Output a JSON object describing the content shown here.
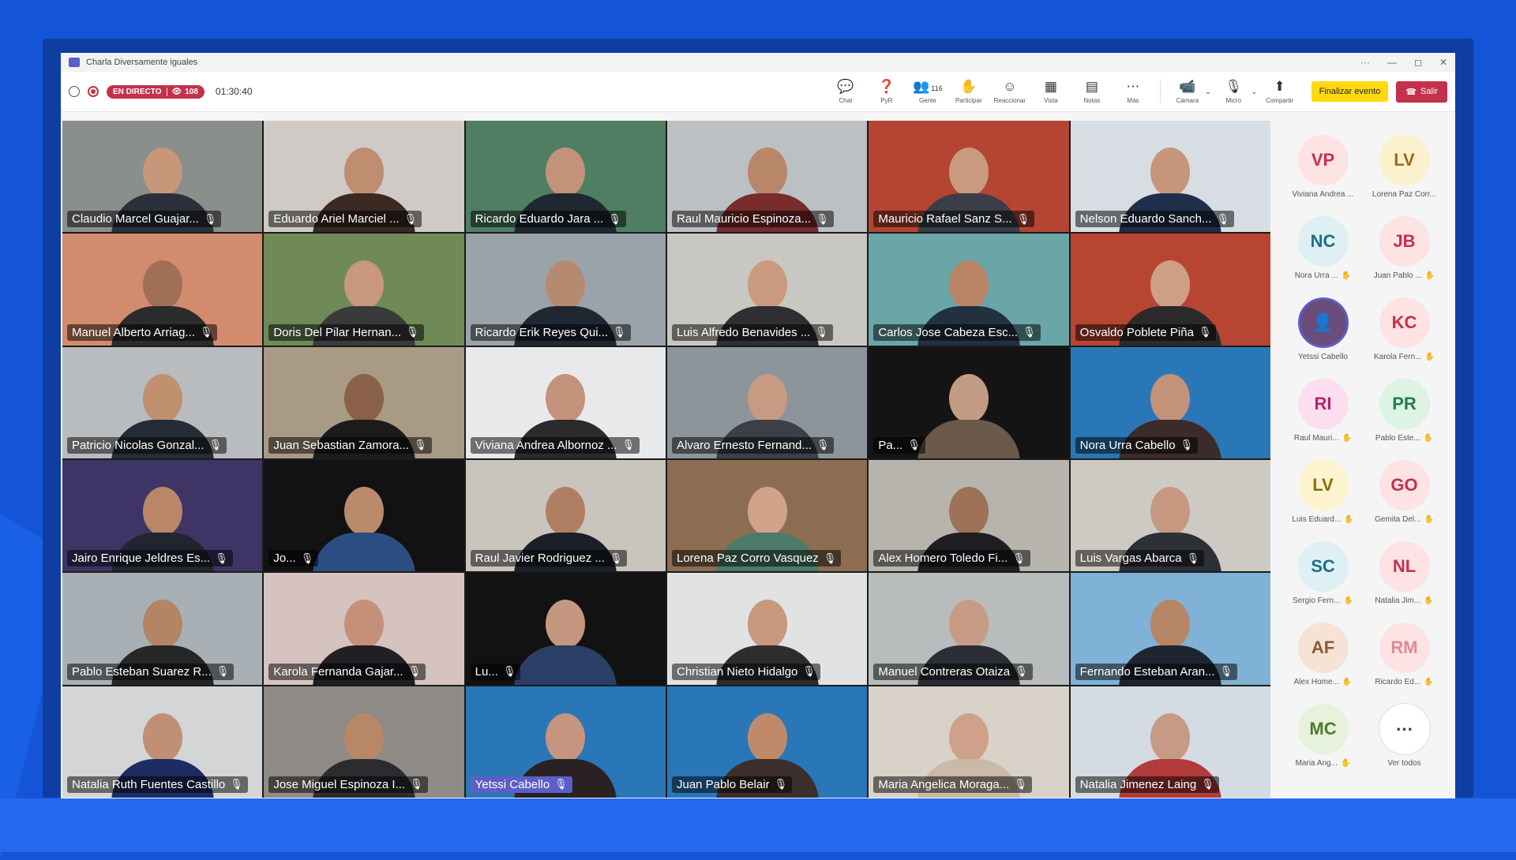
{
  "window": {
    "title": "Charla Diversamente iguales"
  },
  "toolbar": {
    "live_label": "EN DIRECTO",
    "viewers": "108",
    "elapsed": "01:30:40",
    "participant_count": "116",
    "actions": [
      {
        "icon": "chat-icon",
        "glyph": "💬",
        "label": "Chat"
      },
      {
        "icon": "qa-icon",
        "glyph": "❓",
        "label": "PyR"
      },
      {
        "icon": "people-icon",
        "glyph": "👥",
        "label": "Gente"
      },
      {
        "icon": "raise-hand-icon",
        "glyph": "✋",
        "label": "Participar"
      },
      {
        "icon": "react-icon",
        "glyph": "☺",
        "label": "Reaccionar"
      },
      {
        "icon": "view-icon",
        "glyph": "▦",
        "label": "Vista"
      },
      {
        "icon": "notes-icon",
        "glyph": "▤",
        "label": "Notas"
      },
      {
        "icon": "more-icon",
        "glyph": "⋯",
        "label": "Más"
      }
    ],
    "camera_label": "Cámara",
    "mic_label": "Micro",
    "share_label": "Compartir",
    "end_event_label": "Finalizar evento",
    "leave_label": "Salir"
  },
  "grid": {
    "tiles": [
      {
        "name": "Claudio Marcel Guajar...",
        "bg": "#8a8f8c",
        "skin": "#c7977a",
        "shirt": "#2a2f3a"
      },
      {
        "name": "Eduardo Ariel Marciel ...",
        "bg": "#cfcac5",
        "skin": "#bf8d6f",
        "shirt": "#3a2a22"
      },
      {
        "name": "Ricardo Eduardo Jara ...",
        "bg": "#4f7e63",
        "skin": "#c49279",
        "shirt": "#1f2731"
      },
      {
        "name": "Raul Mauricio Espinoza...",
        "bg": "#bcc0c3",
        "skin": "#b88769",
        "shirt": "#7a2b2b"
      },
      {
        "name": "Mauricio Rafael Sanz S...",
        "bg": "#b44533",
        "skin": "#c99a7d",
        "shirt": "#3a3e48"
      },
      {
        "name": "Nelson Eduardo Sanch...",
        "bg": "#d8dde3",
        "skin": "#c6957a",
        "shirt": "#1f2e4a"
      },
      {
        "name": "Manuel Alberto Arriag...",
        "bg": "#d28b6c",
        "skin": "#a06f55",
        "shirt": "#2b2b2b"
      },
      {
        "name": "Doris Del Pilar Hernan...",
        "bg": "#6f8a56",
        "skin": "#c9987c",
        "shirt": "#3a3a3a"
      },
      {
        "name": "Ricardo Erik Reyes Qui...",
        "bg": "#9aa3a9",
        "skin": "#b58a70",
        "shirt": "#1f2733"
      },
      {
        "name": "Luis Alfredo Benavides ...",
        "bg": "#c9c7c2",
        "skin": "#c99a80",
        "shirt": "#2e2e33"
      },
      {
        "name": "Carlos Jose Cabeza Esc...",
        "bg": "#6aa5a8",
        "skin": "#b78566",
        "shirt": "#223040"
      },
      {
        "name": "Osvaldo Poblete Piña",
        "bg": "#b84532",
        "skin": "#cc9f86",
        "shirt": "#2a2a2a"
      },
      {
        "name": "Patricio Nicolas Gonzal...",
        "bg": "#b8bcbf",
        "skin": "#c0906f",
        "shirt": "#262c36"
      },
      {
        "name": "Juan Sebastian Zamora...",
        "bg": "#a99a86",
        "skin": "#8a6048",
        "shirt": "#1c1c1c"
      },
      {
        "name": "Viviana Andrea Albornoz ...",
        "bg": "#e8e9ea",
        "skin": "#c4927b",
        "shirt": "#2c2a2d"
      },
      {
        "name": "Alvaro Ernesto Fernand...",
        "bg": "#8d949a",
        "skin": "#c69b82",
        "shirt": "#3b4048"
      },
      {
        "name": "Pa...",
        "bg": "#141414",
        "skin": "#c39a82",
        "shirt": "#6b5a4a"
      },
      {
        "name": "Nora Urra Cabello",
        "bg": "#2a77b8",
        "skin": "#c4927a",
        "shirt": "#3b2b2b"
      },
      {
        "name": "Jairo Enrique Jeldres Es...",
        "bg": "#3e3566",
        "skin": "#b98768",
        "shirt": "#222430"
      },
      {
        "name": "Jo...",
        "bg": "#121212",
        "skin": "#b98a6c",
        "shirt": "#2c4e83"
      },
      {
        "name": "Raul Javier Rodriguez ...",
        "bg": "#c9c5bd",
        "skin": "#b07f63",
        "shirt": "#1b1f29"
      },
      {
        "name": "Lorena Paz Corro Vasquez",
        "bg": "#8c6d52",
        "skin": "#d1a28a",
        "shirt": "#4e7a6a"
      },
      {
        "name": "Alex Homero Toledo Fi...",
        "bg": "#b7b4ad",
        "skin": "#9d7258",
        "shirt": "#1e1e22"
      },
      {
        "name": "Luis Vargas Abarca",
        "bg": "#cdcac4",
        "skin": "#c7987f",
        "shirt": "#2e3038"
      },
      {
        "name": "Pablo Esteban Suarez R...",
        "bg": "#a8b0b5",
        "skin": "#b48465",
        "shirt": "#262626"
      },
      {
        "name": "Karola Fernanda Gajar...",
        "bg": "#d6c3bf",
        "skin": "#c49077",
        "shirt": "#1f1f24"
      },
      {
        "name": "Lu...",
        "bg": "#121212",
        "skin": "#c59780",
        "shirt": "#2a3e66"
      },
      {
        "name": "Christian Nieto Hidalgo",
        "bg": "#e1e2e2",
        "skin": "#c7977e",
        "shirt": "#2d2d2d"
      },
      {
        "name": "Manuel Contreras Otaiza",
        "bg": "#b9bcbc",
        "skin": "#c89b84",
        "shirt": "#2b2e36"
      },
      {
        "name": "Fernando Esteban Aran...",
        "bg": "#7fb2d6",
        "skin": "#b78666",
        "shirt": "#1f2530"
      },
      {
        "name": "Natalia Ruth Fuentes Castillo",
        "bg": "#d4d5d6",
        "skin": "#c08f76",
        "shirt": "#1d2c63"
      },
      {
        "name": "Jose Miguel Espinoza I...",
        "bg": "#8f8b86",
        "skin": "#b88768",
        "shirt": "#2c2c30"
      },
      {
        "name": "Yetssi Cabello",
        "bg": "#2a77b8",
        "skin": "#c69580",
        "shirt": "#2a2222",
        "highlight": true
      },
      {
        "name": "Juan Pablo Belair",
        "bg": "#2a77b8",
        "skin": "#bf8a6b",
        "shirt": "#3a2f2a"
      },
      {
        "name": "Maria Angelica Moraga...",
        "bg": "#d8d2c8",
        "skin": "#cfa08a",
        "shirt": "#c9b9a6"
      },
      {
        "name": "Natalia Jimenez Laing",
        "bg": "#d5dbe2",
        "skin": "#c79a86",
        "shirt": "#b13a3a"
      }
    ]
  },
  "participants": [
    {
      "initials": "VP",
      "name": "Viviana Andrea ...",
      "bg": "#fde3e3",
      "fg": "#c4314b"
    },
    {
      "initials": "LV",
      "name": "Lorena Paz Corr...",
      "bg": "#fdf0cf",
      "fg": "#9b6a15"
    },
    {
      "initials": "NC",
      "name": "Nora Urra ...",
      "bg": "#dff0f5",
      "fg": "#1d6f85",
      "hand": true
    },
    {
      "initials": "JB",
      "name": "Juan Pablo ...",
      "bg": "#fde3e3",
      "fg": "#c4314b",
      "hand": true
    },
    {
      "initials": "",
      "name": "Yetssi Cabello",
      "photo": true
    },
    {
      "initials": "KC",
      "name": "Karola Fern...",
      "bg": "#fde3e3",
      "fg": "#c4314b",
      "hand": true
    },
    {
      "initials": "RI",
      "name": "Raul Mauri...",
      "bg": "#fbdff0",
      "fg": "#b4236f",
      "hand": true
    },
    {
      "initials": "PR",
      "name": "Pablo Este...",
      "bg": "#ddf3e3",
      "fg": "#237b4b",
      "hand": true
    },
    {
      "initials": "LV",
      "name": "Luis Eduard...",
      "bg": "#fdf3cf",
      "fg": "#8a6d0b",
      "hand": true
    },
    {
      "initials": "GO",
      "name": "Gemita Del...",
      "bg": "#fde3e3",
      "fg": "#c4314b",
      "hand": true
    },
    {
      "initials": "SC",
      "name": "Sergio Fern...",
      "bg": "#dff0f5",
      "fg": "#1d6f85",
      "hand": true
    },
    {
      "initials": "NL",
      "name": "Natalia Jim...",
      "bg": "#fde3e3",
      "fg": "#c4314b",
      "hand": true
    },
    {
      "initials": "AF",
      "name": "Alex Home...",
      "bg": "#f6e3d6",
      "fg": "#8e5a3a",
      "hand": true
    },
    {
      "initials": "RM",
      "name": "Ricardo Ed...",
      "bg": "#fde3e3",
      "fg": "#e08a96",
      "hand": true
    },
    {
      "initials": "MC",
      "name": "Maria Ang...",
      "bg": "#e6f2dc",
      "fg": "#4d7a2a",
      "hand": true
    },
    {
      "initials": "⋯",
      "name": "Ver todos",
      "bg": "#ffffff",
      "fg": "#333333",
      "more": true
    }
  ]
}
